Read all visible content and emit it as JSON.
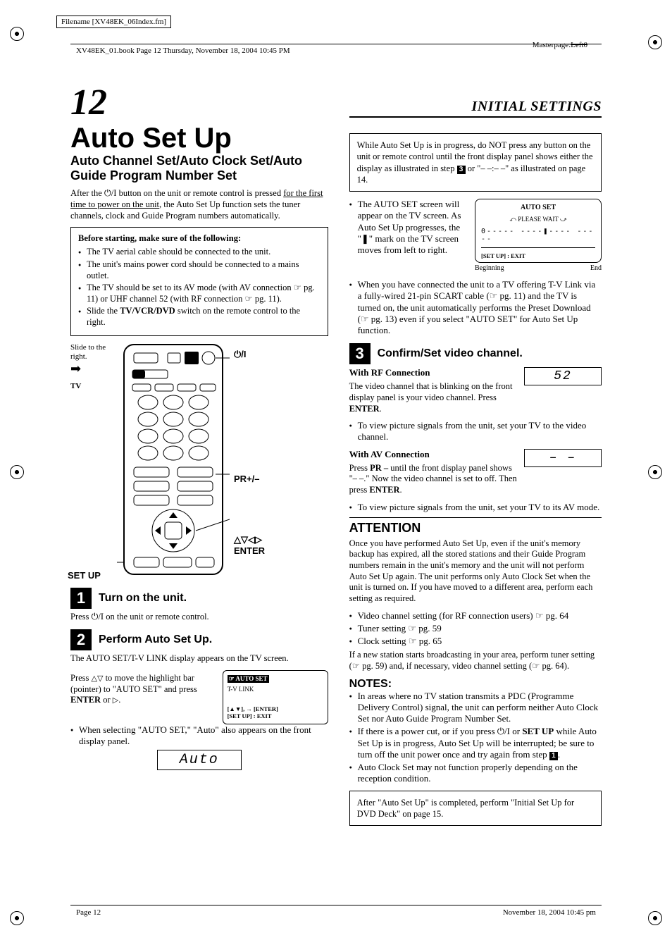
{
  "meta": {
    "filename_label": "Filename [XV48EK_06Index.fm]",
    "masterpage_label": "Masterpage:",
    "masterpage_value": "Left0",
    "header_text": "XV48EK_01.book  Page 12  Thursday, November 18, 2004  10:45 PM",
    "footer_left": "Page 12",
    "footer_right": "November 18, 2004 10:45 pm"
  },
  "page_number": "12",
  "section_title": "INITIAL SETTINGS",
  "title": "Auto Set Up",
  "subtitle": "Auto Channel Set/Auto Clock Set/Auto Guide Program Number Set",
  "intro": {
    "pre": "After the ",
    "btn": "⏻/I",
    "mid": " button on the unit or remote control is pressed ",
    "under": "for the first time to power on the unit",
    "post": ", the Auto Set Up function sets the tuner channels, clock and Guide Program numbers automatically."
  },
  "before": {
    "heading": "Before starting, make sure of the following:",
    "items": [
      "The TV aerial cable should be connected to the unit.",
      "The unit's mains power cord should be connected to a mains outlet.",
      "The TV should be set to its AV mode (with AV connection ☞ pg. 11) or UHF channel 52 (with RF connection ☞ pg. 11).",
      "Slide the TV/VCR/DVD switch on the remote control to the right."
    ]
  },
  "remote": {
    "slide_label": "Slide to the right.",
    "tv_label": "TV",
    "power_label": "⏻/I",
    "pr_label": "PR+/–",
    "arrows_label": "△▽◁▷",
    "enter_label": "ENTER",
    "setup_label": "SET UP"
  },
  "steps": {
    "s1": {
      "num": "1",
      "title": "Turn on the unit.",
      "body_pre": "Press ",
      "body_btn": "⏻/I",
      "body_post": " on the unit or remote control."
    },
    "s2": {
      "num": "2",
      "title": "Perform Auto Set Up.",
      "desc": "The AUTO SET/T-V LINK display appears on the TV screen.",
      "move": "Press △▽ to move the highlight bar (pointer) to \"AUTO SET\" and press ENTER or ▷.",
      "bullet": "When selecting \"AUTO SET,\" \"Auto\" also appears on the front display panel.",
      "lcd": "Auto",
      "screen": {
        "title": "☞ AUTO SET",
        "opt": "T-V LINK",
        "foot1": "[▲▼], → [ENTER]",
        "foot2": "[SET UP] : EXIT"
      }
    },
    "s3": {
      "num": "3",
      "title": "Confirm/Set video channel.",
      "rf_h": "With RF Connection",
      "rf_body": "The video channel that is blinking on the front display panel is your video channel. Press ENTER.",
      "rf_bullet": "To view picture signals from the unit, set your TV to the video channel.",
      "rf_lcd": "52",
      "av_h": "With AV Connection",
      "av_body": "Press PR – until the front display panel shows \"– –.\" Now the video channel is set to off. Then press ENTER.",
      "av_bullet": "To view picture signals from the unit, set your TV to its AV mode.",
      "av_lcd": "– –"
    }
  },
  "right_top_box": {
    "text_pre": "While Auto Set Up is in progress, do NOT press any button on the unit or remote control until the front display panel shows either the display as illustrated in step ",
    "step_ref": "3",
    "text_post": " or \"– –:– –\" as illustrated on page 14."
  },
  "auto_set_progress": {
    "bullet": "The AUTO SET screen will appear on the TV screen. As Auto Set Up progresses, the \"❚\" mark on the TV screen moves from left to right.",
    "screen_title": "AUTO SET",
    "screen_wait": "PLEASE WAIT",
    "screen_exit": "[SET UP] : EXIT",
    "begin": "Beginning",
    "end": "End"
  },
  "tvlink_bullet": "When you have connected the unit to a TV offering T-V Link via a fully-wired 21-pin SCART cable (☞ pg. 11) and the TV is turned on, the unit automatically performs the Preset Download (☞ pg. 13) even if you select \"AUTO SET\" for Auto Set Up function.",
  "attention": {
    "heading": "ATTENTION",
    "body": "Once you have performed Auto Set Up, even if the unit's memory backup has expired, all the stored stations and their Guide Program numbers remain in the unit's memory and the unit will not perform Auto Set Up again. The unit performs only Auto Clock Set when the unit is turned on. If you have moved to a different area, perform each setting as required.",
    "bullets": [
      "Video channel setting (for RF connection users) ☞ pg. 64",
      "Tuner setting ☞ pg. 59",
      "Clock setting ☞ pg. 65"
    ],
    "tail": "If a new station starts broadcasting in your area, perform tuner setting (☞ pg. 59) and, if necessary, video channel setting (☞ pg. 64)."
  },
  "notes": {
    "heading": "NOTES:",
    "items": [
      "In areas where no TV station transmits a PDC (Programme Delivery Control) signal, the unit can perform neither Auto Clock Set nor Auto Guide Program Number Set.",
      "If there is a power cut, or if you press ⏻/I or SET UP while Auto Set Up is in progress, Auto Set Up will be interrupted; be sure to turn off the unit power once and try again from step 1.",
      "Auto Clock Set may not function properly depending on the reception condition."
    ]
  },
  "final_box": "After \"Auto Set Up\" is completed, perform \"Initial Set Up for DVD Deck\" on page 15."
}
